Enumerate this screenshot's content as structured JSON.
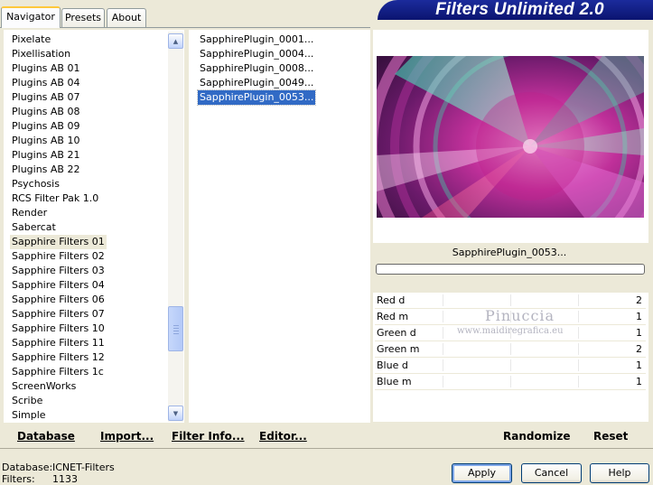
{
  "tabs": [
    "Navigator",
    "Presets",
    "About"
  ],
  "banner_title": "Filters Unlimited 2.0",
  "categories": [
    "Pixelate",
    "Pixellisation",
    "Plugins AB 01",
    "Plugins AB 04",
    "Plugins AB 07",
    "Plugins AB 08",
    "Plugins AB 09",
    "Plugins AB 10",
    "Plugins AB 21",
    "Plugins AB 22",
    "Psychosis",
    "RCS Filter Pak 1.0",
    "Render",
    "Sabercat",
    "Sapphire Filters 01",
    "Sapphire Filters 02",
    "Sapphire Filters 03",
    "Sapphire Filters 04",
    "Sapphire Filters 06",
    "Sapphire Filters 07",
    "Sapphire Filters 10",
    "Sapphire Filters 11",
    "Sapphire Filters 12",
    "Sapphire Filters 1c",
    "ScreenWorks",
    "Scribe",
    "Simple"
  ],
  "selected_category": "Sapphire Filters 01",
  "filters": [
    "SapphirePlugin_0001...",
    "SapphirePlugin_0004...",
    "SapphirePlugin_0008...",
    "SapphirePlugin_0049...",
    "SapphirePlugin_0053..."
  ],
  "selected_filter": "SapphirePlugin_0053...",
  "preview_label": "SapphirePlugin_0053...",
  "params": [
    {
      "name": "Red d",
      "value": "2"
    },
    {
      "name": "Red m",
      "value": "1"
    },
    {
      "name": "Green d",
      "value": "1"
    },
    {
      "name": "Green m",
      "value": "2"
    },
    {
      "name": "Blue d",
      "value": "1"
    },
    {
      "name": "Blue m",
      "value": "1"
    }
  ],
  "watermark": {
    "line1": "Pinuccia",
    "line2": "www.maidiregrafica.eu"
  },
  "toolbar": {
    "database": "Database",
    "import": "Import...",
    "filter_info": "Filter Info...",
    "editor": "Editor...",
    "randomize": "Randomize",
    "reset": "Reset"
  },
  "status": {
    "database_label": "Database:",
    "database_value": "ICNET-Filters",
    "filters_label": "Filters:",
    "filters_value": "1133"
  },
  "buttons": {
    "apply": "Apply",
    "cancel": "Cancel",
    "help": "Help"
  },
  "colors": {
    "selection": "#316ac5",
    "banner": "#1b2b9c",
    "window_bg": "#ece9d8"
  }
}
